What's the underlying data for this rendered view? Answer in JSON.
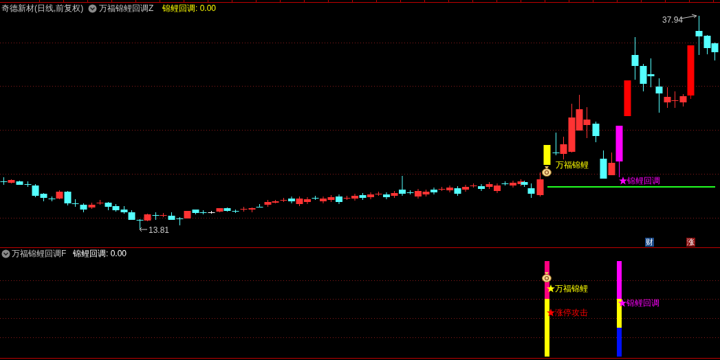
{
  "main_panel": {
    "title": "奇德新材(日线,前复权)",
    "indicator": "万福锦鲤回调Z",
    "readout": "锦鲤回调: 0.00",
    "high_label": "37.94",
    "low_label": "13.81",
    "signals": [
      {
        "kind": "bag",
        "text": "万福锦鲤"
      },
      {
        "kind": "star",
        "text": "锦鲤回调",
        "color": "#ff00ff"
      }
    ],
    "badges": [
      {
        "text": "财",
        "color": "#1a4a8a"
      },
      {
        "text": "涨",
        "color": "#8a1010"
      }
    ]
  },
  "sub_panel": {
    "indicator": "万福锦鲤回调F",
    "readout": "锦鲤回调: 0.00",
    "signals": [
      {
        "kind": "star",
        "text": "万福锦鲤",
        "color": "#ffff00"
      },
      {
        "kind": "star",
        "text": "涨停攻击",
        "color": "#ff0000"
      },
      {
        "kind": "star",
        "text": "锦鲤回调",
        "color": "#ff00ff"
      }
    ]
  }
}
